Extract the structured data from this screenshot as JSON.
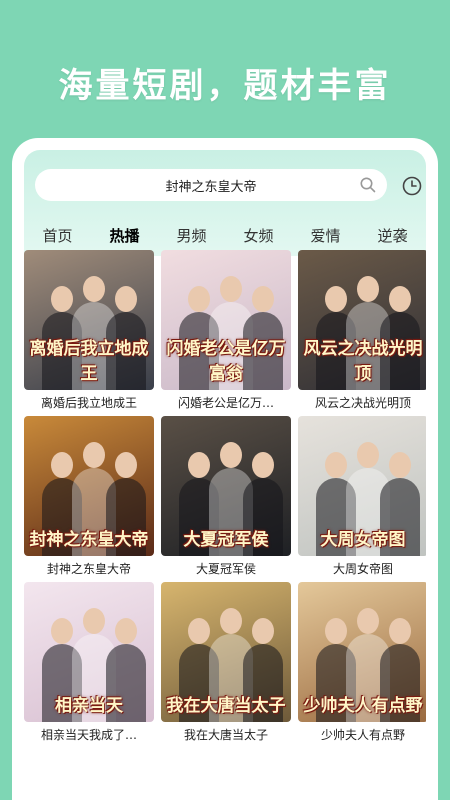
{
  "headline": "海量短剧，题材丰富",
  "search": {
    "value": "封神之东皇大帝"
  },
  "icons": {
    "search": "search-icon",
    "history": "clock-icon"
  },
  "tabs": [
    {
      "label": "首页",
      "active": false
    },
    {
      "label": "热播",
      "active": true
    },
    {
      "label": "男频",
      "active": false
    },
    {
      "label": "女频",
      "active": false
    },
    {
      "label": "爱情",
      "active": false
    },
    {
      "label": "逆袭",
      "active": false
    }
  ],
  "colors": {
    "background": "#7ed6b4",
    "header_tint": "#c9f0e4"
  },
  "dramas": [
    {
      "title": "离婚后我立地成王",
      "poster_text": "离婚后我立地成王",
      "poster_colors": [
        "#3a3f4a",
        "#a08c7a"
      ]
    },
    {
      "title": "闪婚老公是亿万…",
      "poster_text": "闪婚老公是亿万富翁",
      "poster_colors": [
        "#c9b8c8",
        "#f1dde0"
      ]
    },
    {
      "title": "风云之决战光明顶",
      "poster_text": "风云之决战光明顶",
      "poster_colors": [
        "#2f2f35",
        "#6b5a48"
      ]
    },
    {
      "title": "封神之东皇大帝",
      "poster_text": "封神之东皇大帝",
      "poster_colors": [
        "#5a2a18",
        "#c98a3a"
      ]
    },
    {
      "title": "大夏冠军侯",
      "poster_text": "大夏冠军侯",
      "poster_colors": [
        "#1e2024",
        "#5a5046"
      ]
    },
    {
      "title": "大周女帝图",
      "poster_text": "大周女帝图",
      "poster_colors": [
        "#bfc3c0",
        "#e6e2dc"
      ]
    },
    {
      "title": "相亲当天我成了…",
      "poster_text": "相亲当天",
      "poster_colors": [
        "#d8c0d2",
        "#f3e6ee"
      ]
    },
    {
      "title": "我在大唐当太子",
      "poster_text": "我在大唐当太子",
      "poster_colors": [
        "#6e5a3a",
        "#d7b56e"
      ]
    },
    {
      "title": "少帅夫人有点野",
      "poster_text": "少帅夫人有点野",
      "poster_colors": [
        "#9a6a40",
        "#e4c89a"
      ]
    }
  ]
}
